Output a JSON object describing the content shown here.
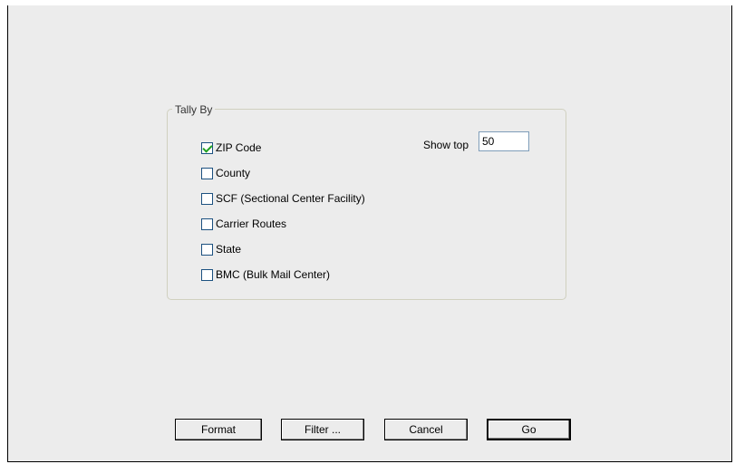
{
  "tally_group": {
    "title": "Tally By",
    "options": [
      {
        "label": "ZIP Code",
        "checked": true
      },
      {
        "label": "County",
        "checked": false
      },
      {
        "label": "SCF (Sectional Center Facility)",
        "checked": false
      },
      {
        "label": "Carrier Routes",
        "checked": false
      },
      {
        "label": "State",
        "checked": false
      },
      {
        "label": "BMC (Bulk Mail Center)",
        "checked": false
      }
    ]
  },
  "show_top": {
    "label": "Show top",
    "value": "50"
  },
  "buttons": {
    "format": "Format",
    "filter": "Filter ...",
    "cancel": "Cancel",
    "go": "Go"
  }
}
